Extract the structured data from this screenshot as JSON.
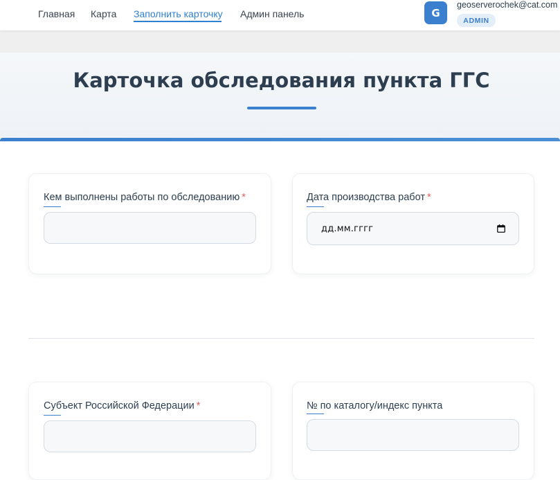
{
  "nav": {
    "links": [
      {
        "label": "Главная"
      },
      {
        "label": "Карта"
      },
      {
        "label": "Заполнить карточку"
      },
      {
        "label": "Админ панель"
      }
    ],
    "active_link": "Заполнить карточку"
  },
  "user": {
    "avatar_letter": "G",
    "email": "geoserverochek@cat.com",
    "role": "ADMIN"
  },
  "page": {
    "title": "Карточка обследования пункта ГГС"
  },
  "form": {
    "fields": [
      {
        "label": "Кем выполнены работы по обследованию",
        "required": "*",
        "value": "",
        "type": "text"
      },
      {
        "label": "Дата производства работ",
        "required": "*",
        "value": "",
        "placeholder": "дд.мм.гггг",
        "type": "date"
      },
      {
        "label": "Субъект Российской Федерации",
        "required": "*",
        "value": "",
        "type": "text"
      },
      {
        "label": "№ по каталогу/индекс пункта",
        "value": "",
        "type": "text"
      }
    ]
  },
  "colors": {
    "accent": "#3a80cf",
    "nav_active": "#2f80d1",
    "required": "#e35d5d",
    "title": "#2c3e50"
  },
  "icons": {
    "date_picker": "calendar-icon"
  }
}
